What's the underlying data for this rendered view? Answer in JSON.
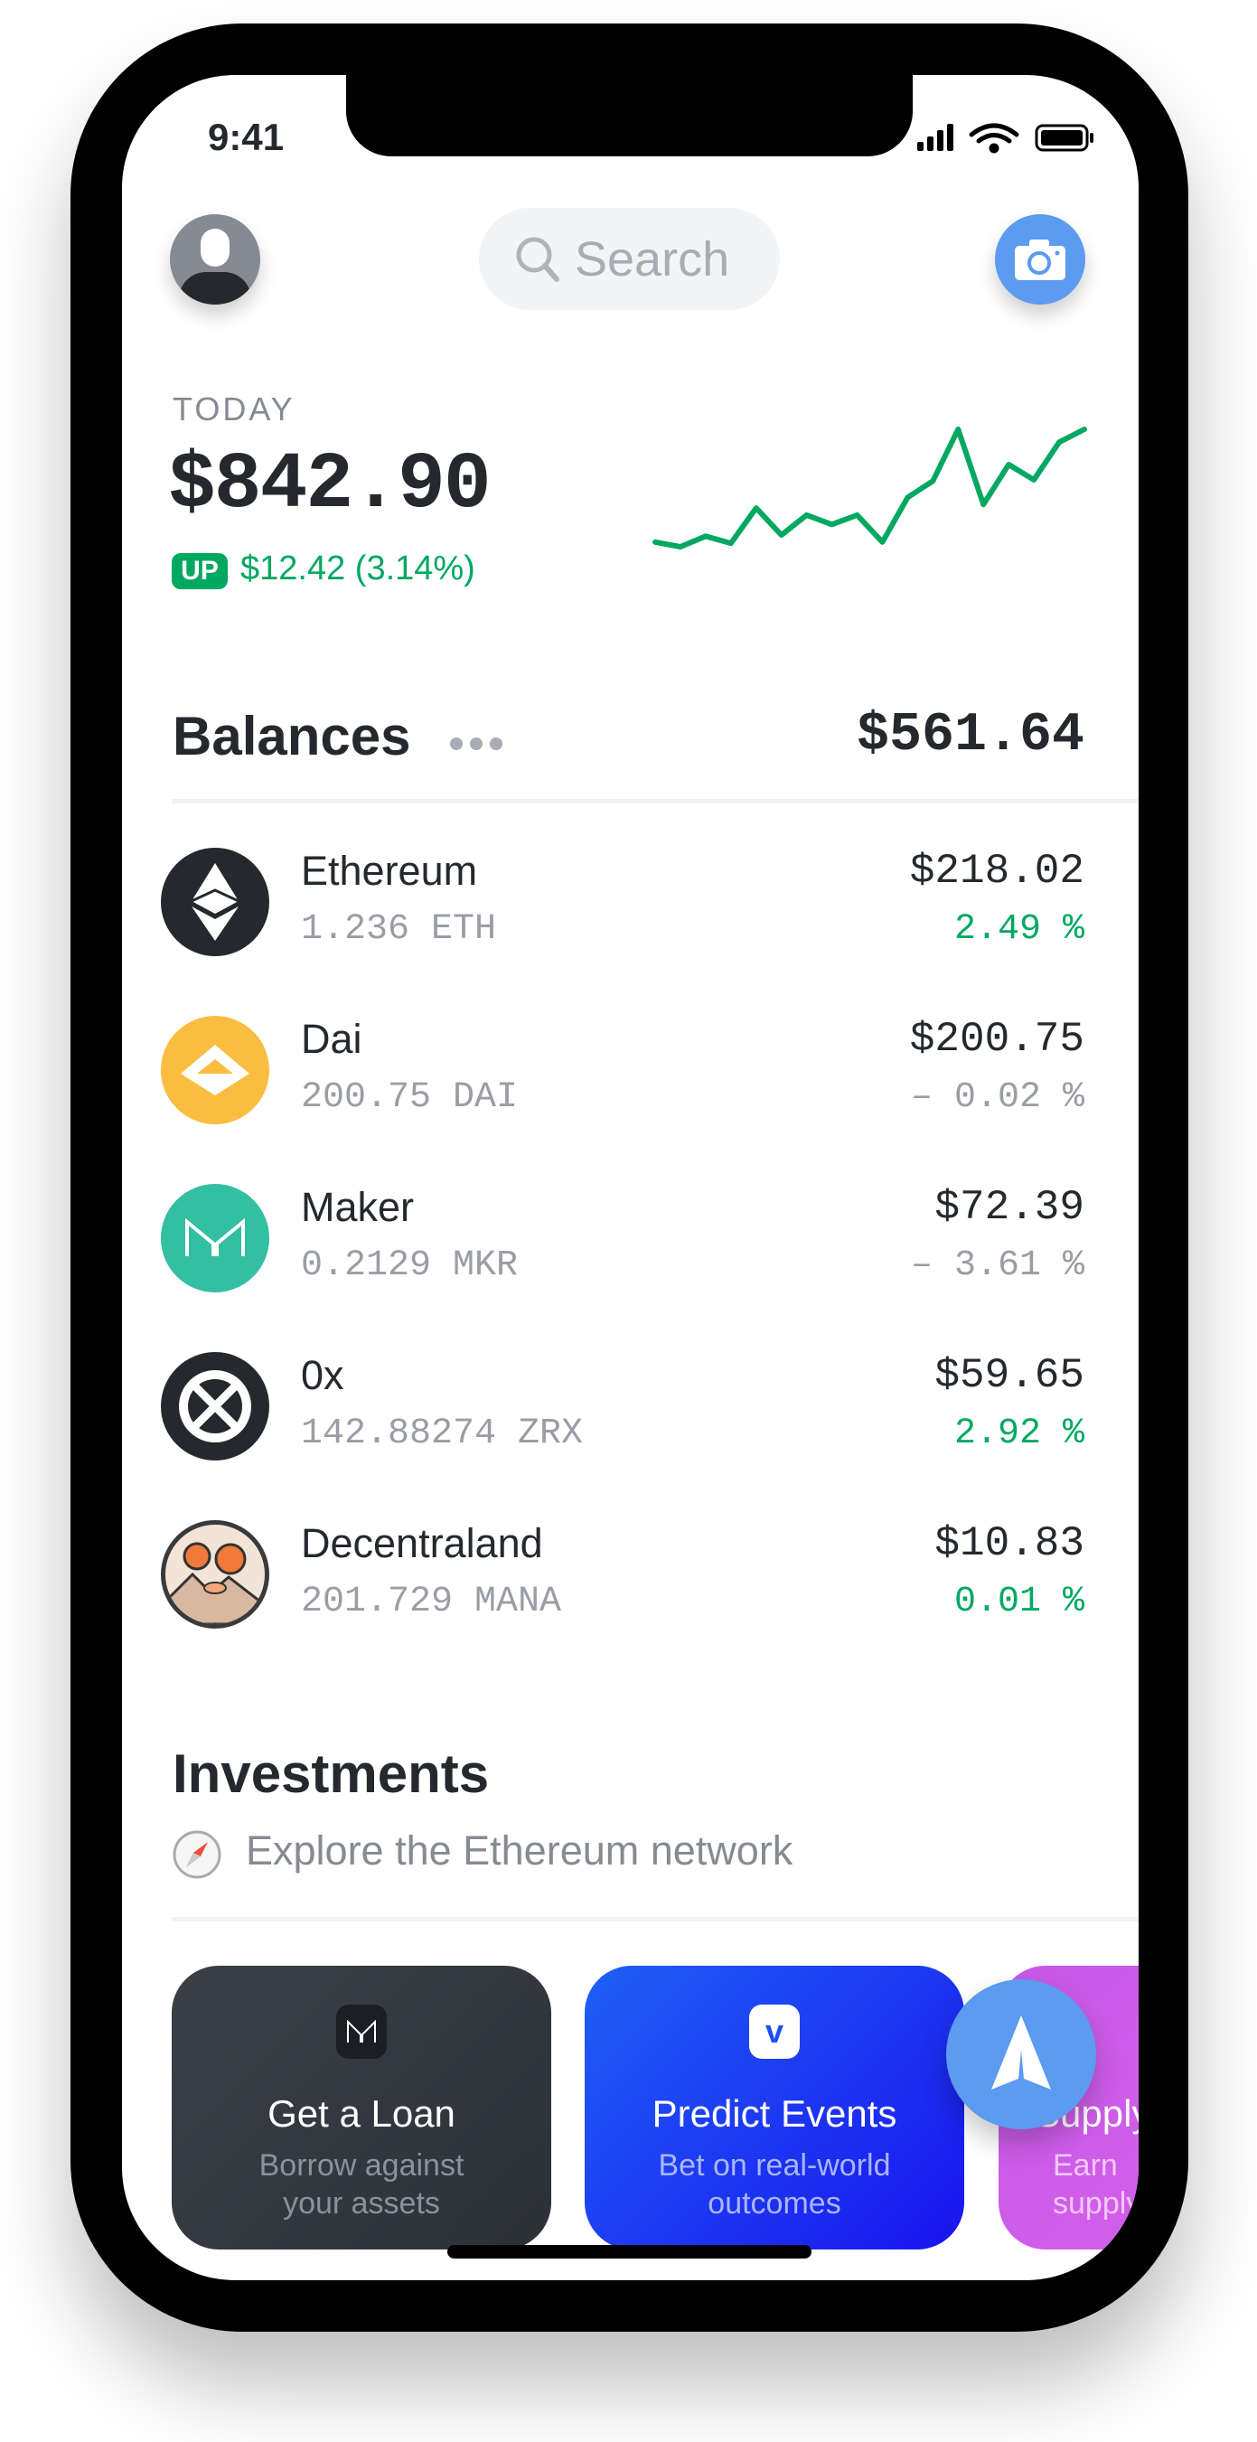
{
  "status_bar": {
    "time": "9:41"
  },
  "header": {
    "search_placeholder": "Search"
  },
  "today": {
    "label": "TODAY",
    "total": "$842.90",
    "badge": "UP",
    "change": "$12.42 (3.14%)"
  },
  "chart_data": {
    "type": "line",
    "title": "",
    "xlabel": "",
    "ylabel": "",
    "color": "#00a862",
    "values": [
      4,
      0,
      9,
      3,
      33,
      10,
      27,
      19,
      27,
      4,
      42,
      56,
      100,
      36,
      70,
      57,
      89,
      100
    ],
    "ylim": [
      0,
      100
    ]
  },
  "balances": {
    "title": "Balances",
    "total": "$561.64",
    "items": [
      {
        "name": "Ethereum",
        "amount": "1.236 ETH",
        "value": "$218.02",
        "change": "2.49 %",
        "trend": "up"
      },
      {
        "name": "Dai",
        "amount": "200.75 DAI",
        "value": "$200.75",
        "change": "– 0.02 %",
        "trend": "down"
      },
      {
        "name": "Maker",
        "amount": "0.2129 MKR",
        "value": "$72.39",
        "change": "– 3.61 %",
        "trend": "down"
      },
      {
        "name": "0x",
        "amount": "142.88274 ZRX",
        "value": "$59.65",
        "change": "2.92 %",
        "trend": "up"
      },
      {
        "name": "Decentraland",
        "amount": "201.729 MANA",
        "value": "$10.83",
        "change": "0.01 %",
        "trend": "up"
      }
    ]
  },
  "investments": {
    "title": "Investments",
    "subtitle": "Explore the Ethereum network",
    "cards": [
      {
        "title": "Get a Loan",
        "subtitle": "Borrow against your assets"
      },
      {
        "title": "Predict Events",
        "subtitle": "Bet on real-world outcomes"
      },
      {
        "title": "Supply",
        "subtitle": "Earn supply"
      }
    ]
  },
  "colors": {
    "green": "#00a862",
    "blue": "#5b9bf0"
  }
}
